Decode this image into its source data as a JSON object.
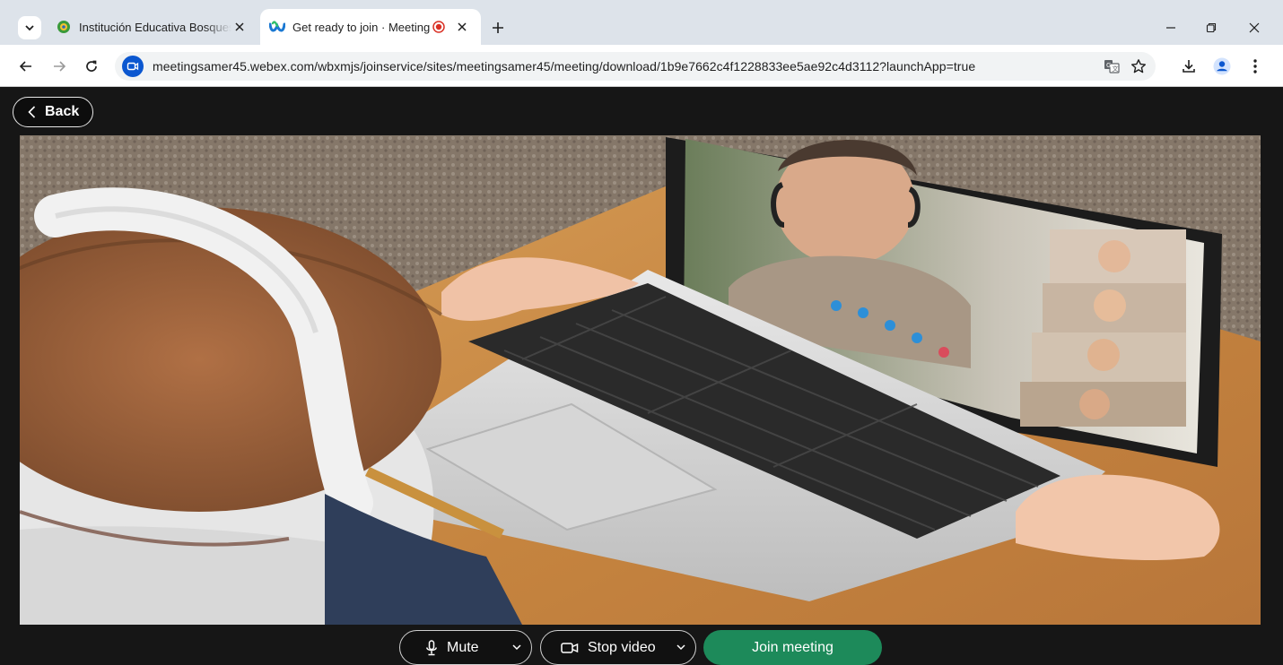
{
  "browser": {
    "tabs": [
      {
        "title": "Institución Educativa Bosques d",
        "active": false
      },
      {
        "title": "Get ready to join · Meeting",
        "active": true
      }
    ],
    "url": "meetingsamer45.webex.com/wbxmjs/joinservice/sites/meetingsamer45/meeting/download/1b9e7662c4f1228833ee5ae92c4d3112?launchApp=true"
  },
  "page": {
    "back_label": "Back",
    "mute_label": "Mute",
    "stop_video_label": "Stop video",
    "join_label": "Join meeting"
  },
  "icons": {
    "tab_search": "chevron-down-icon",
    "school_favicon": "school-crest-icon",
    "webex_favicon": "webex-icon",
    "recording": "recording-indicator-icon",
    "translate": "translate-icon",
    "bookmark": "star-icon",
    "download": "download-icon",
    "profile": "profile-icon",
    "menu": "kebab-menu-icon",
    "microphone": "microphone-icon",
    "camera": "camera-icon"
  },
  "colors": {
    "join_button": "#1d8a5a",
    "page_background": "#161616",
    "tabstrip": "#dde3ea",
    "recording": "#d93025",
    "site_icon": "#0b57d0"
  }
}
